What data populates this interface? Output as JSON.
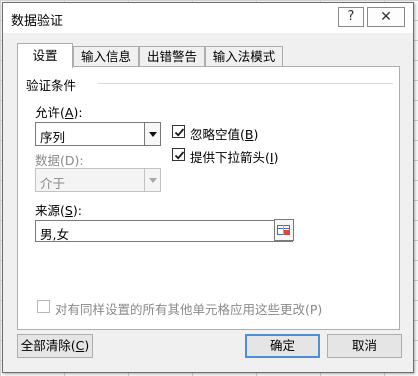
{
  "window": {
    "title": "数据验证",
    "help_glyph": "?",
    "close_glyph": "✕"
  },
  "tabs": [
    {
      "label": "设置",
      "active": true
    },
    {
      "label": "输入信息",
      "active": false
    },
    {
      "label": "出错警告",
      "active": false
    },
    {
      "label": "输入法模式",
      "active": false
    }
  ],
  "settings": {
    "group_title": "验证条件",
    "allow": {
      "label_pre": "允许(",
      "accel": "A",
      "label_post": "):",
      "value": "序列"
    },
    "data": {
      "label": "数据(D):",
      "value": "介于",
      "disabled": true
    },
    "ignore_blank": {
      "label_pre": "忽略空值(",
      "accel": "B",
      "label_post": ")",
      "checked": true
    },
    "dropdown": {
      "label_pre": "提供下拉箭头(",
      "accel": "I",
      "label_post": ")",
      "checked": true
    },
    "source": {
      "label_pre": "来源(",
      "accel": "S",
      "label_post": "):",
      "value": "男,女"
    },
    "apply_all": {
      "label": "对有同样设置的所有其他单元格应用这些更改(P)",
      "checked": false,
      "disabled": true
    }
  },
  "buttons": {
    "clear_all": {
      "label_pre": "全部清除(",
      "accel": "C",
      "label_post": ")"
    },
    "ok": "确定",
    "cancel": "取消"
  },
  "icons": {
    "help": "help-icon",
    "close": "close-icon",
    "checkmark": "checkmark-icon",
    "collapse": "range-select-icon"
  },
  "colors": {
    "accent": "#4a90d9",
    "check": "#1a1a1a"
  }
}
